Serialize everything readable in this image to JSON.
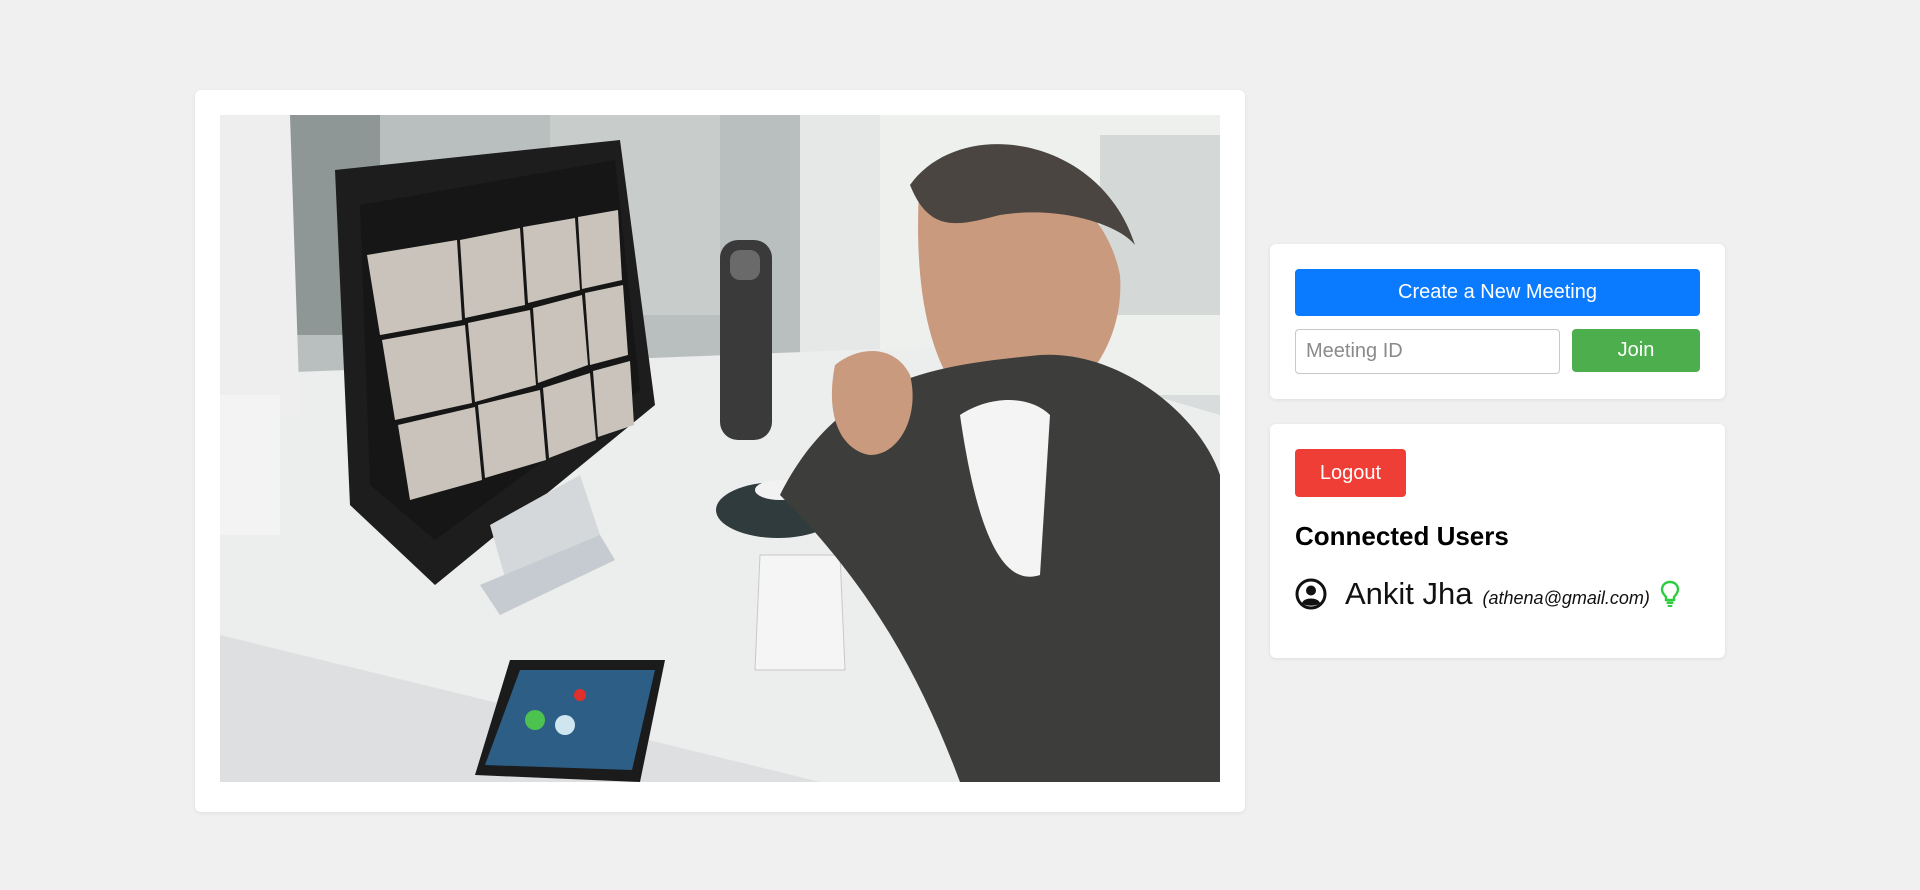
{
  "hero_image": {
    "alt": "Man on a video call at a desktop computer",
    "icon": "video-conference-photo"
  },
  "meeting": {
    "create_label": "Create a New Meeting",
    "meeting_id_placeholder": "Meeting ID",
    "meeting_id_value": "",
    "join_label": "Join"
  },
  "session": {
    "logout_label": "Logout"
  },
  "connected_users": {
    "title": "Connected Users",
    "users": [
      {
        "name": "Ankit Jha",
        "email": "(athena@gmail.com)",
        "avatar_icon": "user-circle-icon",
        "status_icon": "lightbulb-icon",
        "status_color": "#2ecc40"
      }
    ]
  },
  "colors": {
    "primary": "#0a7bff",
    "success": "#4cae4c",
    "danger": "#ef3e36",
    "background": "#f0f0f0",
    "card": "#ffffff"
  }
}
